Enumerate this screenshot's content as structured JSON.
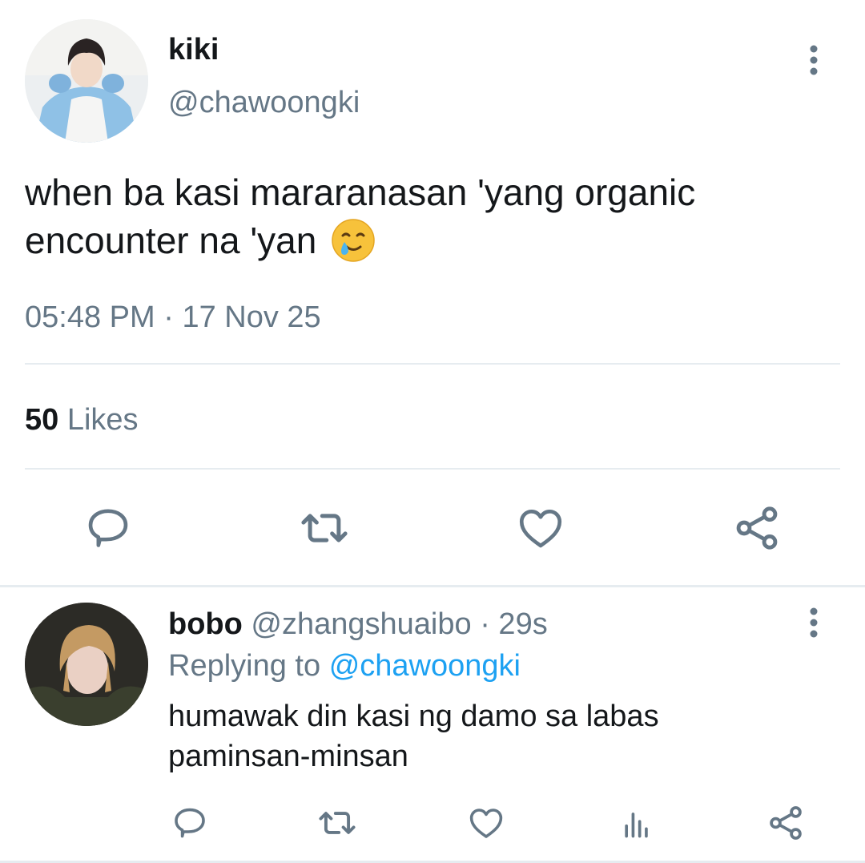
{
  "tweet": {
    "author": {
      "name": "kiki",
      "handle": "@chawoongki"
    },
    "text_line1": "when ba kasi mararanasan 'yang organic",
    "text_line2": "encounter na 'yan",
    "emoji": "smiling-face-with-tear",
    "time": "05:48 PM",
    "separator": "·",
    "date": "17 Nov 25",
    "likes_count": "50",
    "likes_label": "Likes"
  },
  "reply": {
    "author": {
      "name": "bobo",
      "handle": "@zhangshuaibo"
    },
    "age": "· 29s",
    "replying_label": "Replying to",
    "replying_handle": "@chawoongki",
    "text_line1": "humawak din kasi ng damo sa labas",
    "text_line2": "paminsan-minsan"
  },
  "colors": {
    "accent": "#1da1f2",
    "muted": "#657786",
    "icon": "#657786",
    "divider": "#e6ecf0"
  },
  "icons": [
    "more-vertical-icon",
    "reply-icon",
    "retweet-icon",
    "heart-icon",
    "share-icon",
    "analytics-icon"
  ]
}
